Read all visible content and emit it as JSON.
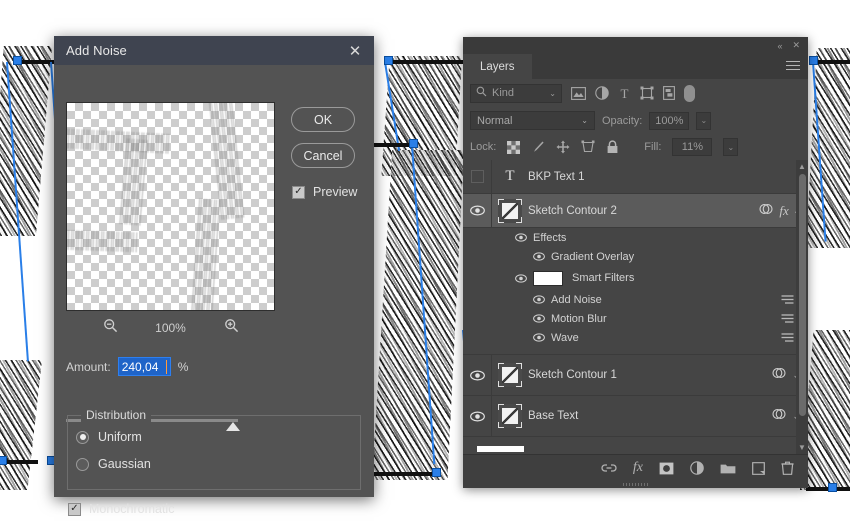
{
  "dialog": {
    "title": "Add Noise",
    "close_icon": "close-icon",
    "preview_zoom": {
      "zoom_out_icon": "zoom-out-icon",
      "level": "100%",
      "zoom_in_icon": "zoom-in-icon"
    },
    "amount": {
      "label": "Amount:",
      "value": "240,04",
      "unit": "%",
      "selected": true
    },
    "distribution": {
      "legend": "Distribution",
      "options": [
        {
          "label": "Uniform",
          "selected": true
        },
        {
          "label": "Gaussian",
          "selected": false
        }
      ]
    },
    "monochromatic": {
      "label": "Monochromatic",
      "checked": true
    },
    "buttons": {
      "ok": "OK",
      "cancel": "Cancel"
    },
    "preview_toggle": {
      "label": "Preview",
      "checked": true
    }
  },
  "layers_panel": {
    "window_controls": {
      "collapse": "«",
      "close": "✕"
    },
    "tab": "Layers",
    "menu_icon": "hamburger-menu-icon",
    "filter": {
      "kind_label": "Kind",
      "search_icon": "search-icon",
      "chevron": "⌄",
      "icons": [
        "pixel-layer-filter-icon",
        "adjustment-layer-filter-icon",
        "type-layer-filter-icon",
        "shape-layer-filter-icon",
        "smart-object-filter-icon"
      ],
      "toggle": "filter-enable-toggle"
    },
    "blend": {
      "mode": "Normal",
      "chevron": "⌄",
      "opacity_label": "Opacity:",
      "opacity_value": "100%",
      "stepper": "⌄"
    },
    "lock": {
      "label": "Lock:",
      "icons": [
        "lock-transparent-pixels-icon",
        "lock-image-pixels-icon",
        "lock-position-icon",
        "lock-artboard-icon",
        "lock-all-icon"
      ],
      "fill_label": "Fill:",
      "fill_value": "11%",
      "stepper": "⌄"
    },
    "layers": [
      {
        "name": "BKP Text 1",
        "type": "text",
        "thumb_icon": "type-layer-icon",
        "visible": false,
        "selected": false
      },
      {
        "name": "Sketch Contour 2",
        "type": "smart-object",
        "thumb_icon": "smart-object-thumbnail",
        "visible": true,
        "selected": true,
        "badges": [
          "smart-object-badge",
          "fx"
        ],
        "chevron": "˄",
        "children": [
          {
            "name": "Effects",
            "indent": 1,
            "visible": true
          },
          {
            "name": "Gradient Overlay",
            "indent": 2,
            "visible": true
          },
          {
            "name": "Smart Filters",
            "indent": 1,
            "visible": true,
            "mask": true
          },
          {
            "name": "Add Noise",
            "indent": 2,
            "visible": true,
            "settings_icon": "filter-settings-icon"
          },
          {
            "name": "Motion Blur",
            "indent": 2,
            "visible": true,
            "settings_icon": "filter-settings-icon"
          },
          {
            "name": "Wave",
            "indent": 2,
            "visible": true,
            "settings_icon": "filter-settings-icon"
          }
        ]
      },
      {
        "name": "Sketch Contour 1",
        "type": "smart-object",
        "thumb_icon": "smart-object-thumbnail",
        "visible": true,
        "selected": false,
        "badges": [
          "smart-object-badge"
        ],
        "chevron": "⌄"
      },
      {
        "name": "Base Text",
        "type": "smart-object",
        "thumb_icon": "smart-object-thumbnail",
        "visible": true,
        "selected": false,
        "badges": [
          "smart-object-badge"
        ],
        "chevron": "⌄"
      }
    ],
    "bottom_icons": [
      "link-layers-icon",
      "add-layer-style-icon",
      "add-layer-mask-icon",
      "new-adjustment-layer-icon",
      "new-group-icon",
      "new-layer-icon",
      "delete-layer-icon"
    ]
  },
  "colors": {
    "dialog_bg": "#535353",
    "dialog_titlebar": "#3f4450",
    "panel_bg": "#454545",
    "panel_chrome": "#3a3a3a",
    "selection_blue": "#1f64c8",
    "transform_blue": "#2a7fe8",
    "caret_orange": "#ff9b3d",
    "text_light": "#d8d8d8"
  }
}
